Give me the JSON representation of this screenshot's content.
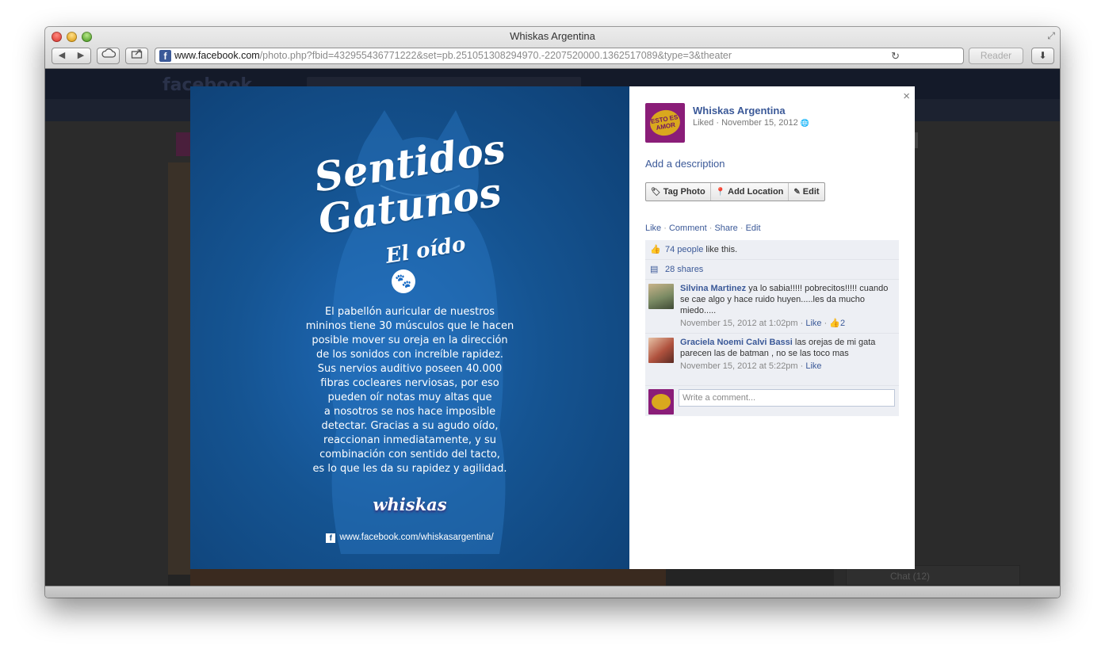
{
  "browser": {
    "window_title": "Whiskas Argentina",
    "url_host": "www.facebook.com",
    "url_path": "/photo.php?fbid=432955436771222&set=pb.251051308294970.-2207520000.1362517089&type=3&theater",
    "reader_label": "Reader",
    "back_glyph": "◀",
    "forward_glyph": "▶",
    "reload_glyph": "↻",
    "download_glyph": "⬇",
    "fullscreen_glyph": "⤢",
    "favicon_letter": "f"
  },
  "background": {
    "fb_logo": "facebook",
    "chat_label": "Chat (12)"
  },
  "photo": {
    "title_line1": "Sentidos",
    "title_line2": "Gatunos",
    "title_line3": "El oído",
    "paw_glyph": "🐾",
    "body_lines": [
      "El pabellón auricular de nuestros",
      "mininos tiene 30 músculos que le hacen",
      "posible mover su oreja en la dirección",
      "de los sonidos con increíble rapidez.",
      "Sus nervios auditivo poseen 40.000",
      "fibras cocleares nerviosas, por eso",
      "pueden oír notas muy altas que",
      "a nosotros se nos hace imposible",
      "detectar. Gracias a su agudo oído,",
      "reaccionan inmediatamente, y su",
      "combinación con sentido del tacto,",
      "es lo que les da su rapidez y agilidad."
    ],
    "brand": "whiskas",
    "url": "www.facebook.com/whiskasargentina/"
  },
  "sidebar": {
    "close_glyph": "×",
    "page_name": "Whiskas Argentina",
    "avatar_text": "ESTO ES AMOR",
    "meta": "Liked · November 15, 2012",
    "meta_icon": "🌐",
    "add_description": "Add a description",
    "buttons": [
      {
        "label": "Tag Photo",
        "icon": "tag-icon",
        "glyph": "🏷"
      },
      {
        "label": "Add Location",
        "icon": "map-pin-icon",
        "glyph": "📍"
      },
      {
        "label": "Edit",
        "icon": "pencil-icon",
        "glyph": "✎"
      }
    ],
    "actions": {
      "like": "Like",
      "comment": "Comment",
      "share": "Share",
      "edit": "Edit"
    },
    "likes": {
      "count_link": "74 people",
      "suffix": " like this.",
      "glyph": "👍"
    },
    "shares": {
      "label": "28 shares",
      "glyph": "▤"
    },
    "comments": [
      {
        "author": "Silvina Martinez",
        "text": "ya lo sabia!!!!! pobrecitos!!!!! cuando se cae algo y hace ruido huyen.....les da mucho miedo.....",
        "time": "November 15, 2012 at 1:02pm",
        "like": "Like",
        "likes_count": "2",
        "avatar_color": "#7a8a63"
      },
      {
        "author": "Graciela Noemi Calvi Bassi",
        "text": "las orejas de mi gata parecen las de batman , no se las toco mas",
        "time": "November 15, 2012 at 5:22pm",
        "like": "Like",
        "avatar_color": "#b0523e"
      }
    ],
    "write_placeholder": "Write a comment..."
  },
  "colors": {
    "fb_blue": "#3b5998",
    "photo_blue": "#155492",
    "whiskas_purple": "#8a1d78"
  }
}
